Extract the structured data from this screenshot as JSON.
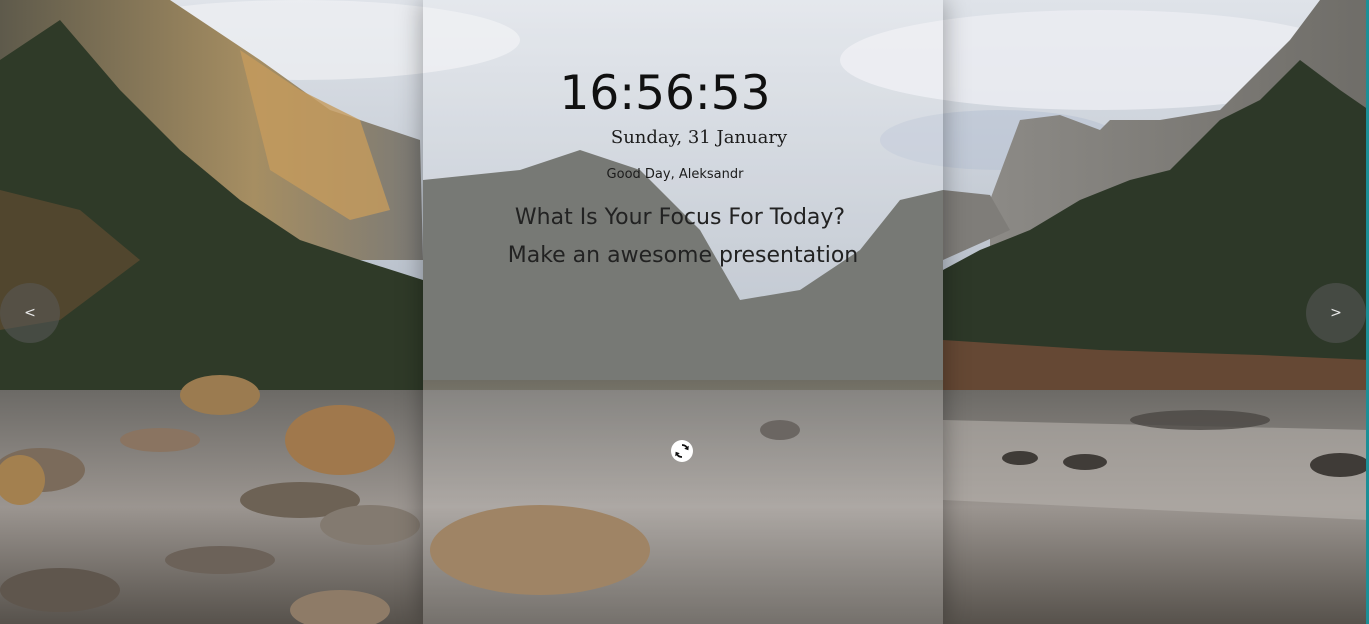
{
  "clock": {
    "time": "16:56:53"
  },
  "date": {
    "text": "Sunday, 31 January"
  },
  "greeting": {
    "text": "Good Day, Aleksandr"
  },
  "focus": {
    "question": "What Is Your Focus For Today?",
    "answer": "Make an awesome presentation"
  },
  "controls": {
    "prev_label": "<",
    "next_label": ">",
    "refresh_icon": "refresh-icon"
  },
  "background": {
    "description_icon": "landscape-image"
  },
  "colors": {
    "accent_edge": "#1c8f96",
    "text": "#1a1a1a",
    "nav_button_bg": "#5a5a5a"
  }
}
